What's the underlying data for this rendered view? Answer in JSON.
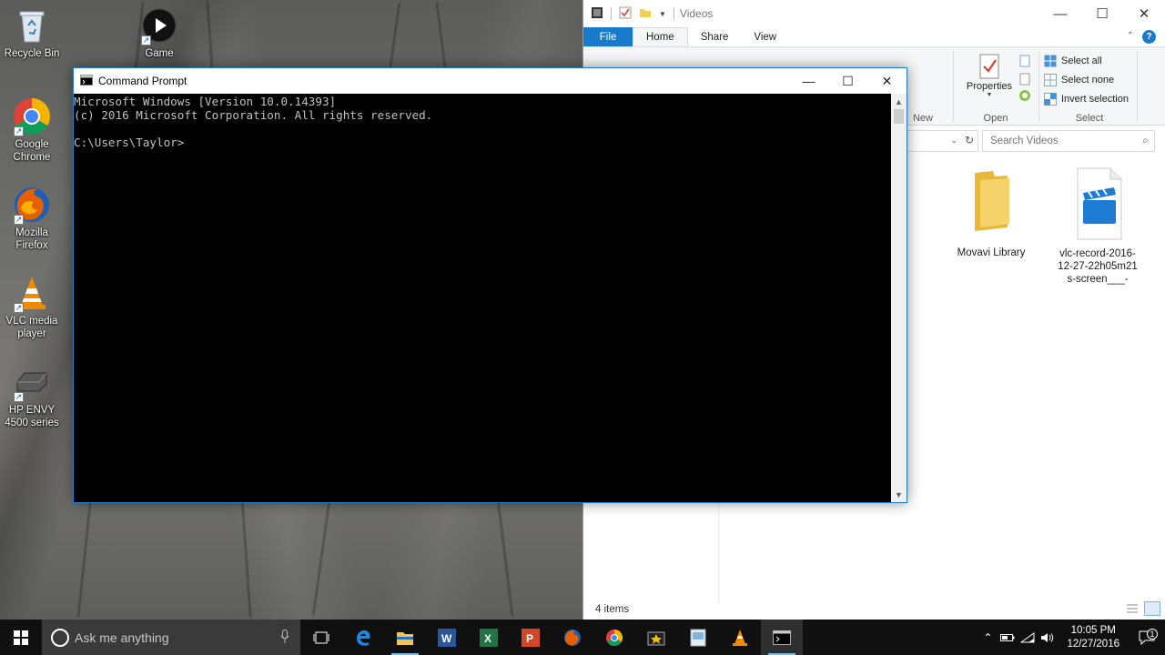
{
  "desktop": {
    "icons": [
      {
        "label": "Recycle Bin"
      },
      {
        "label": "Game"
      },
      {
        "label": "Google Chrome"
      },
      {
        "label": "Mozilla Firefox"
      },
      {
        "label": "VLC media player"
      },
      {
        "label": "HP ENVY 4500 series"
      }
    ]
  },
  "explorer": {
    "title": "Videos",
    "tabs": [
      "File",
      "Home",
      "Share",
      "View"
    ],
    "ribbon": {
      "new_label": "New",
      "open_label": "Open",
      "properties_label": "Properties",
      "select_label": "Select",
      "select_all": "Select all",
      "select_none": "Select none",
      "invert_selection": "Invert selection"
    },
    "search_placeholder": "Search Videos",
    "items": [
      {
        "name": "Movavi Library",
        "type": "folder"
      },
      {
        "name": "vlc-record-2016-12-27-22h05m21s-screen___-",
        "type": "video"
      }
    ],
    "status": "4 items"
  },
  "cmd": {
    "title": "Command Prompt",
    "lines": [
      "Microsoft Windows [Version 10.0.14393]",
      "(c) 2016 Microsoft Corporation. All rights reserved.",
      "",
      "C:\\Users\\Taylor>"
    ]
  },
  "taskbar": {
    "search_placeholder": "Ask me anything",
    "time": "10:05 PM",
    "date": "12/27/2016",
    "notification_count": "1"
  },
  "colors": {
    "accent": "#1979ca",
    "cmd_background": "#000000",
    "cmd_text": "#c0c0c0",
    "taskbar": "#101010"
  }
}
